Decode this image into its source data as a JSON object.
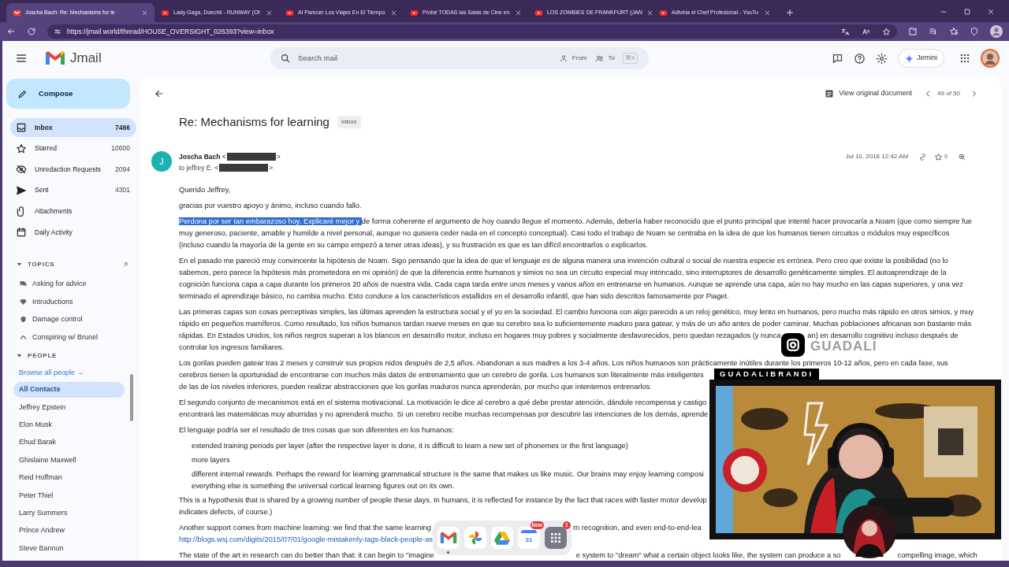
{
  "browser": {
    "tabs": [
      {
        "kind": "mail",
        "title": "Joscha Bach: Re: Mechanisms for le",
        "selected": true
      },
      {
        "kind": "video",
        "title": "Lady Gaga, Doechii - RUNWAY (Of",
        "selected": false
      },
      {
        "kind": "video",
        "title": "Al Parecer Los Viajes En El Tiempo",
        "selected": false
      },
      {
        "kind": "video",
        "title": "Probé TODAS las Salas de Cine en",
        "selected": false
      },
      {
        "kind": "video",
        "title": "LOS ZOMBIES DE FRANKFURT (JAN",
        "selected": false
      },
      {
        "kind": "video",
        "title": "Adivina el Chef Profesional - YouTu",
        "selected": false
      }
    ],
    "url": "https://jmail.world/thread/HOUSE_OVERSIGHT_026393?view=inbox"
  },
  "header": {
    "app_name": "Jmail",
    "search": {
      "placeholder": "Search mail",
      "from": "From",
      "to": "To",
      "shortcut": "⌘K"
    },
    "assistant": "Jemini"
  },
  "sidebar": {
    "compose": "Compose",
    "nav": [
      {
        "label": "Inbox",
        "count": "7466",
        "selected": true
      },
      {
        "label": "Starred",
        "count": "10600",
        "selected": false
      },
      {
        "label": "Unredaction Requests",
        "count": "2094",
        "selected": false
      },
      {
        "label": "Sent",
        "count": "4301",
        "selected": false
      },
      {
        "label": "Attachments",
        "selected": false
      },
      {
        "label": "Daily Activity",
        "selected": false
      }
    ],
    "topics": {
      "title": "TOPICS",
      "expanded": true,
      "items": [
        "Asking for advice",
        "Introductions",
        "Damage control",
        "Conspiring w/ Brunel"
      ]
    },
    "people": {
      "title": "PEOPLE",
      "expanded": true,
      "browse": "Browse all people →",
      "items": [
        {
          "name": "All Contacts",
          "selected": true
        },
        {
          "name": "Jeffrey Epstein",
          "selected": false
        },
        {
          "name": "Elon Musk",
          "selected": false
        },
        {
          "name": "Ehud Barak",
          "selected": false
        },
        {
          "name": "Ghislaine Maxwell",
          "selected": false
        },
        {
          "name": "Reid Hoffman",
          "selected": false
        },
        {
          "name": "Peter Thiel",
          "selected": false
        },
        {
          "name": "Larry Summers",
          "selected": false
        },
        {
          "name": "Prince Andrew",
          "selected": false
        },
        {
          "name": "Steve Bannon",
          "selected": false
        }
      ]
    }
  },
  "thread": {
    "view_original": "View original document",
    "counter": "49 of 50",
    "subject": "Re: Mechanisms for learning",
    "label": "Inbox",
    "message": {
      "avatar": "J",
      "sender": "**Joscha Bach** <",
      "sender_close": ">",
      "recipient": "to jeffrey E. <",
      "recipient_close": ">",
      "date": "Jul 10, 2016 12:42 AM",
      "star_count": "9",
      "starred": false,
      "body": [
        {
          "kind": "paragraph",
          "lines": [
            "Querido Jeffrey,"
          ]
        },
        {
          "kind": "paragraph",
          "lines": [
            "gracias por vuestro apoyo y ánimo, incluso cuando fallo."
          ]
        },
        {
          "kind": "paragraph",
          "lines": [
            {
              "kind": "selection",
              "highlighted": "Perdona por ser tan embarazoso hoy. Explicaré mejor y ",
              "text": "de forma coherente el argumento de hoy cuando llegue el momento. Además, debería haber reconocido que el punto principal que intenté hacer provocaría a Noam (que como siempre fue"
            },
            "muy generoso, paciente, amable y humilde a nivel personal, aunque no quisiera ceder nada en el concepto conceptual). Casi todo el trabajo de Noam se centraba en la idea de que los humanos tienen circuitos o módulos muy específicos",
            "(incluso cuando la mayoría de la gente en su campo empezó a tener otras ideas), y su frustración es que es tan difícil encontrarlos o explicarlos."
          ]
        },
        {
          "kind": "paragraph",
          "lines": [
            "En el pasado me pareció muy convincente la hipótesis de Noam. Sigo pensando que la idea de que el lenguaje es de alguna manera una invención cultural o social de nuestra especie es errónea. Pero creo que existe la posibilidad (no lo",
            "sabemos, pero parece la hipótesis más prometedora en mi opinión) de que la diferencia entre humanos y simios no sea un circuito especial muy intrincado, sino interruptores de desarrollo genéticamente simples. El autoaprendizaje de la",
            "cognición funciona capa a capa durante los primeros 20 años de nuestra vida. Cada capa tarda entre unos meses y varios años en entrenarse en humanos. Aunque se aprende una capa, aún no hay mucho en las capas superiores, y una vez",
            "terminado el aprendizaje básico, no cambia mucho. Esto conduce a los característicos estallidos en el desarrollo infantil, que han sido descritos famosamente por Piaget."
          ]
        },
        {
          "kind": "paragraph",
          "lines": [
            "Las primeras capas son cosas perceptivas simples, las últimas aprenden la estructura social y el yo en la sociedad. El cambio funciona con algo parecido a un reloj genético, muy lento en humanos, pero mucho más rápido en otros simios, y muy",
            "rápido en pequeños mamíferos. Como resultado, los niños humanos tardan nueve meses en que su cerebro sea lo suficientemente maduro para gatear, y más de un año antes de poder caminar. Muchas poblaciones africanas son bastante más",
            {
              "kind": "gapped",
              "segments": [
                "rápidas. En Estados Unidos, los niños negros superan a los blancos en desarrollo motor, incluso en hogares muy pobres y socialmente desfavorecidos, pero quedan rezagados (y nunca",
                "an) en desarrollo cognitivo incluso después de"
              ]
            },
            "controlar los ingresos familiares."
          ]
        },
        {
          "kind": "paragraph",
          "lines": [
            "Los gorilas pueden gatear tras 2 meses y construir sus propios nidos después de 2,5 años. Abandonan a sus madres a los 3-4 años. Los niños humanos son prácticamente inútiles durante los primeros 10-12 años, pero en cada fase, sus",
            "cerebros tienen la oportunidad de encontrarse con muchos más datos de entrenamiento que un cerebro de gorila. Los humanos son literalmente más inteligentes",
            "de las de los niveles inferiores, pueden realizar abstracciones que los gorilas maduros nunca aprenderán, por mucho que intentemos entrenarlos."
          ]
        },
        {
          "kind": "paragraph",
          "lines": [
            "El segundo conjunto de mecanismos está en el sistema motivacional. La motivación le dice al cerebro a qué debe prestar atención, dándole recompensa y castigo",
            "encontrará las matemáticas muy aburridas y no aprenderá mucho. Si un cerebro recibe muchas recompensas por descubrir las intenciones de los demás, aprende"
          ]
        },
        {
          "kind": "paragraph",
          "lines": [
            "El lenguaje podría ser el resultado de tres cosas que son diferentes en los humanos:"
          ]
        },
        {
          "kind": "list_item",
          "lines": [
            "extended training periods per layer (after the respective layer is done, it is difficult to learn a new set of phonemes or the first language)"
          ]
        },
        {
          "kind": "list_item",
          "lines": [
            "more layers"
          ]
        },
        {
          "kind": "list_item",
          "lines": [
            "different internal rewards. Perhaps the reward for learning grammatical structure is the same that makes us like music. Our brains may enjoy learning composi",
            "everything else is something the universal cortical learning figures out on its own."
          ]
        },
        {
          "kind": "paragraph",
          "lines": [
            "This is a hypothesis that is shared by a growing number of people these days. In humans, it is reflected for instance by the fact that races with faster motor develop",
            "indicates defects, of course.)"
          ]
        },
        {
          "kind": "paragraph",
          "lines": [
            {
              "kind": "gapped",
              "segments": [
                "Another support comes from machine learning: we find that the same learning",
                "rn recognition, and even end-to-end-lea"
              ]
            },
            {
              "kind": "link",
              "text": "http://blogs.wsj.com/digits/2015/07/01/google-mistakenly-tags-black-people-as"
            }
          ]
        },
        {
          "kind": "paragraph",
          "lines": [
            {
              "kind": "gapped",
              "segments": [
                "The state of the art in research can do better than that: it can begin to \"imagine",
                "e system to \"dream\" what a certain object looks like, the system can produce a so",
                "compelling image, which"
              ]
            }
          ]
        }
      ]
    }
  },
  "stream_overlay": {
    "handle": "GUADALI",
    "channel": "GUADALIBRANDI"
  },
  "dock": {
    "apps": [
      {
        "kind": "gmail",
        "running": true
      },
      {
        "kind": "photos",
        "running": false
      },
      {
        "kind": "drive",
        "running": false
      },
      {
        "kind": "calendar",
        "date": "31",
        "badge": "New",
        "running": false
      },
      {
        "kind": "apps",
        "badge": "1",
        "running": false
      }
    ]
  }
}
